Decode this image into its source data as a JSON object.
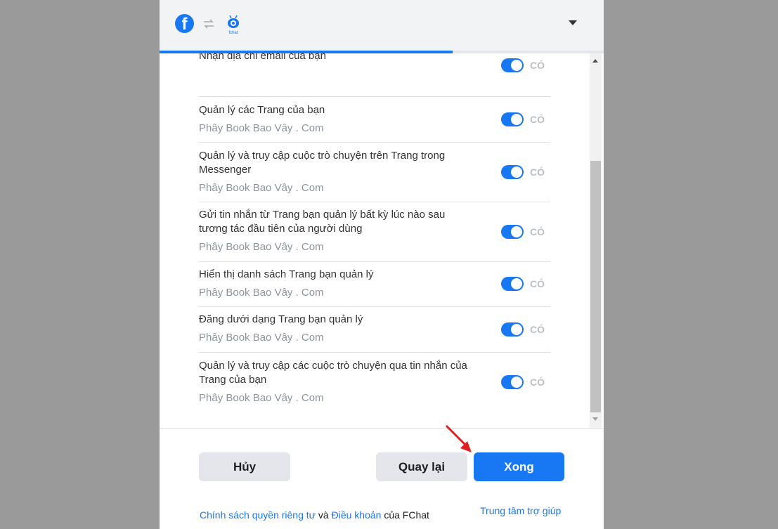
{
  "header": {
    "facebook_logo_letter": "f",
    "fchat_logo_text": "fchat",
    "progress_percent": 66
  },
  "permissions": [
    {
      "title": "Nhận địa chỉ email của bạn",
      "subtitle": "",
      "toggle_on": true,
      "toggle_label": "CÓ"
    },
    {
      "title": "Quản lý các Trang của bạn",
      "subtitle": "Phây Book Bao Vây . Com",
      "toggle_on": true,
      "toggle_label": "CÓ"
    },
    {
      "title": "Quản lý và truy cập cuộc trò chuyện trên Trang trong Messenger",
      "subtitle": "Phây Book Bao Vây . Com",
      "toggle_on": true,
      "toggle_label": "CÓ"
    },
    {
      "title": "Gửi tin nhắn từ Trang bạn quản lý bất kỳ lúc nào sau tương tác đầu tiên của người dùng",
      "subtitle": "Phây Book Bao Vây . Com",
      "toggle_on": true,
      "toggle_label": "CÓ"
    },
    {
      "title": "Hiển thị danh sách Trang bạn quản lý",
      "subtitle": "Phây Book Bao Vây . Com",
      "toggle_on": true,
      "toggle_label": "CÓ"
    },
    {
      "title": "Đăng dưới dạng Trang bạn quản lý",
      "subtitle": "Phây Book Bao Vây . Com",
      "toggle_on": true,
      "toggle_label": "CÓ"
    },
    {
      "title": "Quản lý và truy cập các cuộc trò chuyện qua tin nhắn của Trang của bạn",
      "subtitle": "Phây Book Bao Vây . Com",
      "toggle_on": true,
      "toggle_label": "CÓ"
    }
  ],
  "buttons": {
    "cancel": "Hủy",
    "back": "Quay lại",
    "done": "Xong"
  },
  "footer": {
    "privacy_link": "Chính sách quyền riêng tư",
    "and_text": " và ",
    "terms_link": "Điều khoản",
    "of_text": " của FChat",
    "help_link": "Trung tâm trợ giúp"
  },
  "colors": {
    "accent": "#1877f2",
    "annotation_arrow": "#e02020"
  }
}
